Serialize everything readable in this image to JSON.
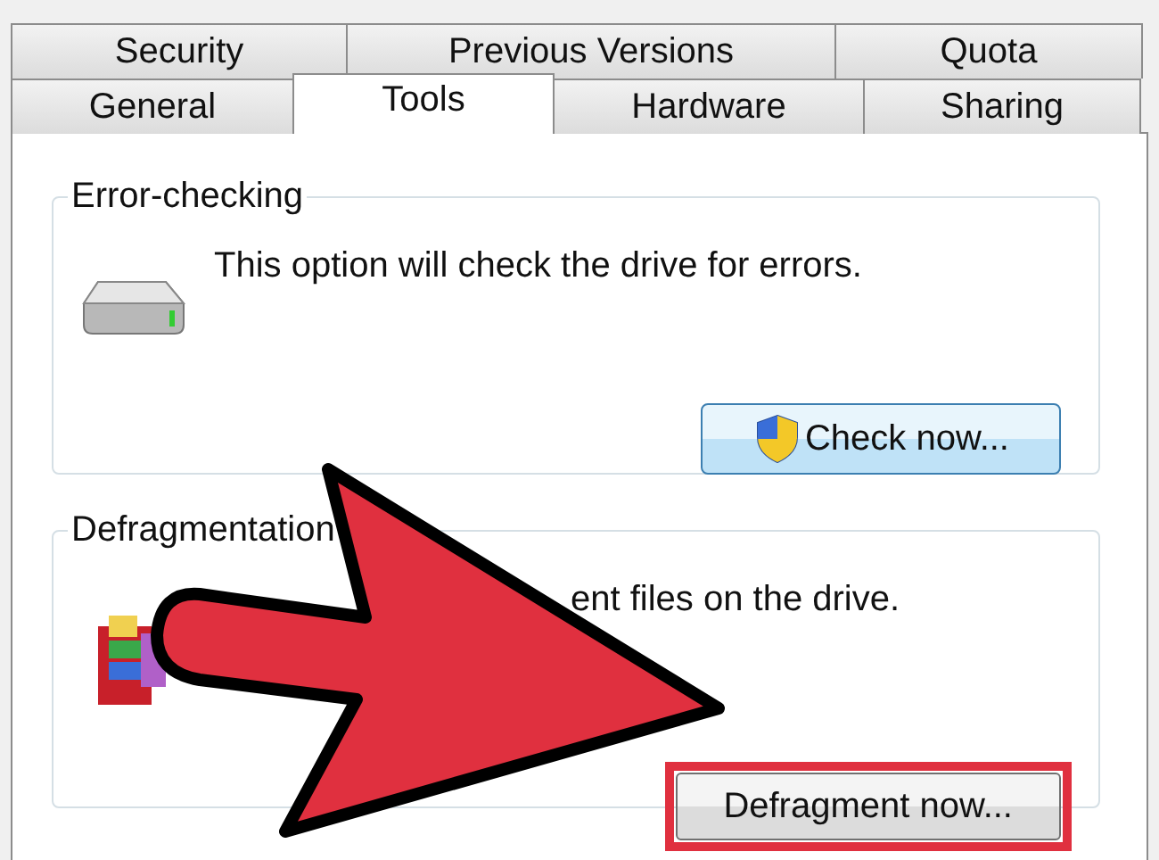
{
  "tab_rows": [
    [
      {
        "label": "Security",
        "selected": false
      },
      {
        "label": "Previous Versions",
        "selected": false
      },
      {
        "label": "Quota",
        "selected": false
      }
    ],
    [
      {
        "label": "General",
        "selected": false
      },
      {
        "label": "Tools",
        "selected": true
      },
      {
        "label": "Hardware",
        "selected": false
      },
      {
        "label": "Sharing",
        "selected": false
      }
    ]
  ],
  "groups": [
    {
      "title": "Error-checking",
      "kind": "check",
      "text": "This option will check the drive for errors.",
      "button": {
        "label": "Check now...",
        "highlighted": false
      }
    },
    {
      "title": "Defragmentation",
      "kind": "defrag",
      "text": "ent files on the drive.",
      "button": {
        "label": "Defragment now...",
        "highlighted": true
      }
    }
  ]
}
